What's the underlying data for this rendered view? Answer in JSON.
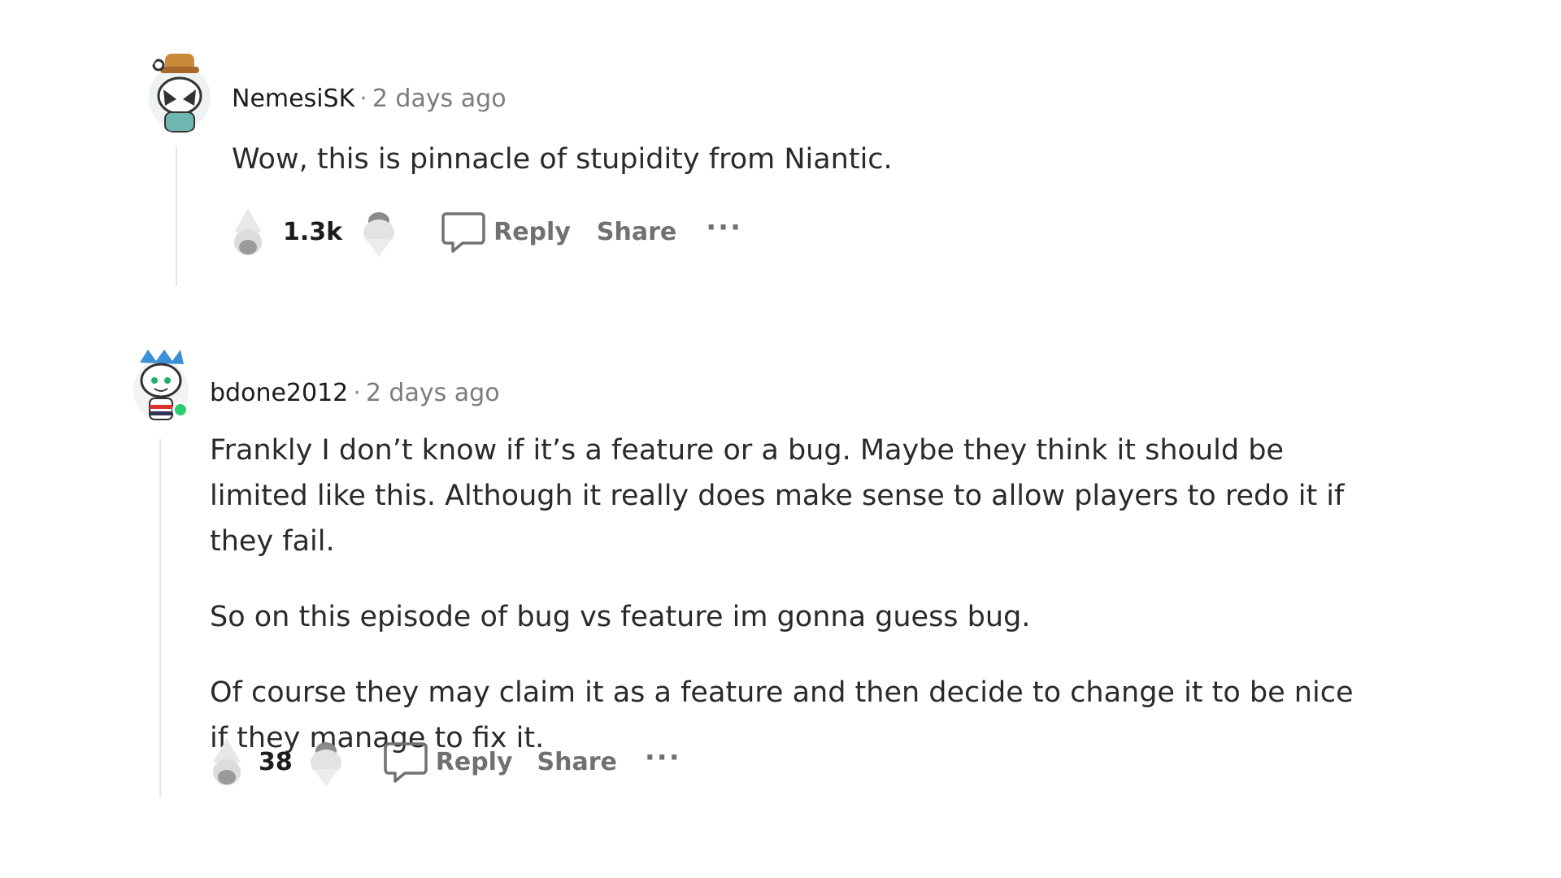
{
  "comments": [
    {
      "author": "NemesiSK",
      "separator": "·",
      "time": "2 days ago",
      "paragraphs": [
        "Wow, this is pinnacle of stupidity from Niantic."
      ],
      "votes": "1.3k",
      "reply_label": "Reply",
      "share_label": "Share",
      "more_label": "···"
    },
    {
      "author": "bdone2012",
      "separator": "·",
      "time": "2 days ago",
      "paragraphs": [
        "Frankly I don’t know if it’s a feature or a bug. Maybe they think it should be limited like this. Although it really does make sense to allow players to redo it if they fail.",
        "So on this episode of bug vs feature im gonna guess bug.",
        "Of course they may claim it as a feature and then decide to change it to be nice if they manage to fix it."
      ],
      "votes": "38",
      "reply_label": "Reply",
      "share_label": "Share",
      "more_label": "···"
    }
  ],
  "colors": {
    "online_indicator": "#2ecc71",
    "thread_line": "#e4e6e8"
  }
}
